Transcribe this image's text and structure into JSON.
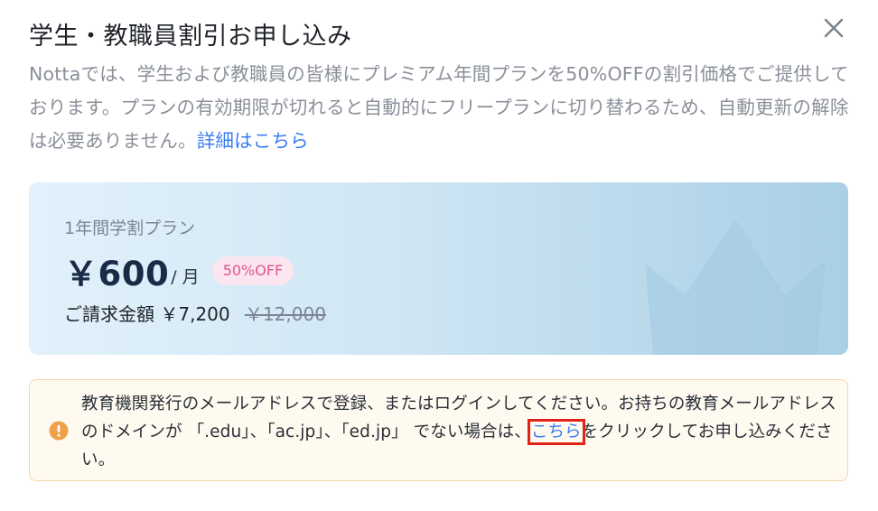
{
  "dialog": {
    "title": "学生・教職員割引お申し込み",
    "close_icon": "close-icon"
  },
  "description": {
    "text": "Nottaでは、学生および教職員の皆様にプレミアム年間プランを50%OFFの割引価格でご提供しております。プランの有効期限が切れると自動的にフリープランに切り替わるため、自動更新の解除は必要ありません。",
    "link": "詳細はこちら"
  },
  "plan": {
    "name": "1年間学割プラン",
    "price": "￥600",
    "per": "/ 月",
    "discount": "50%OFF",
    "billing_label": "ご請求金額",
    "billing_amount": "￥7,200",
    "original_amount": "￥12,000",
    "decoration_icon": "crown-icon"
  },
  "notice": {
    "icon": "warning-icon",
    "text_before": "教育機関発行のメールアドレスで登録、またはログインしてください。お持ちの教育メールアドレスのドメインが 「.edu」、「ac.jp」、「ed.jp」 でない場合は、",
    "link": "こちら",
    "text_after": "をクリックしてお申し込みください。"
  },
  "colors": {
    "link": "#3a7bf2",
    "price": "#1a2b48",
    "discount_text": "#e0578a",
    "discount_bg": "#fbe6ef",
    "notice_border": "#f6d7a7",
    "notice_bg": "#fffaf0",
    "warning": "#f0a04b",
    "highlight": "#e0241a"
  }
}
